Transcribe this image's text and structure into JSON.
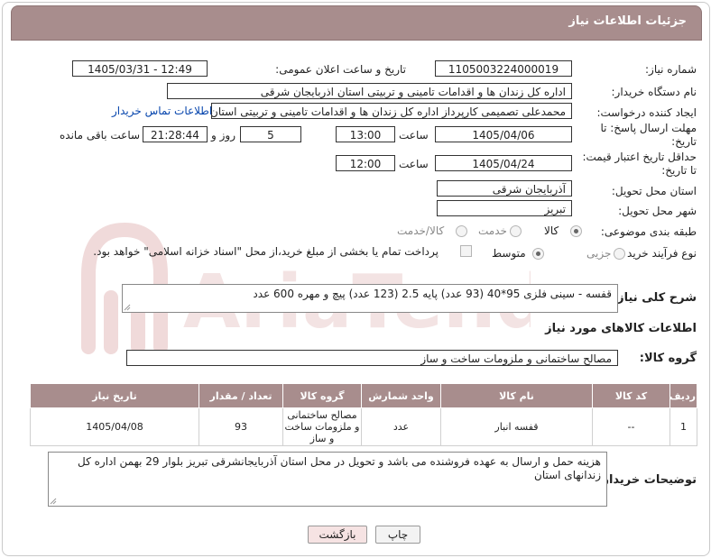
{
  "header": {
    "title": "جزئیات اطلاعات نیاز"
  },
  "fields": {
    "need_number": {
      "label": "شماره نیاز:",
      "value": "1105003224000019"
    },
    "announce": {
      "label": "تاریخ و ساعت اعلان عمومی:",
      "value": "1405/03/31 - 12:49"
    },
    "buyer_org": {
      "label": "نام دستگاه خریدار:",
      "value": "اداره کل زندان ها و اقدامات تامینی و تربیتی استان اذربایجان شرقی"
    },
    "requester": {
      "label": "ایجاد کننده درخواست:",
      "value": "محمدعلی تصمیمی کارپرداز اداره کل زندان ها و اقدامات تامینی و تربیتی استان",
      "contact_link": "اطلاعات تماس خریدار"
    },
    "reply_deadline": {
      "label_line1": "مهلت ارسال پاسخ: تا",
      "label_line2": "تاریخ:",
      "date": "1405/04/06",
      "time_label": "ساعت",
      "time": "13:00",
      "days": "5",
      "days_label": "روز و",
      "remaining": "21:28:44",
      "remaining_label": "ساعت باقی مانده"
    },
    "price_validity": {
      "label_line1": "حداقل تاریخ اعتبار قیمت:",
      "label_line2": "تا تاریخ:",
      "date": "1405/04/24",
      "time_label": "ساعت",
      "time": "12:00"
    },
    "delivery_province": {
      "label": "استان محل تحویل:",
      "value": "آذربایجان شرقی"
    },
    "delivery_city": {
      "label": "شهر محل تحویل:",
      "value": "تبریز"
    },
    "category": {
      "label": "طبقه بندی موضوعی:",
      "options": [
        "کالا",
        "خدمت",
        "کالا/خدمت"
      ],
      "selected": "کالا"
    },
    "process": {
      "label": "نوع فرآیند خرید :",
      "options": [
        "جزیی",
        "متوسط"
      ],
      "selected": "متوسط",
      "payment_note": "پرداخت تمام یا بخشی از مبلغ خرید،از محل \"اسناد خزانه اسلامی\" خواهد بود."
    }
  },
  "description": {
    "label": "شرح کلی نیاز:",
    "value": "قفسه - سینی فلزی 95*40 (93 عدد) پایه 2.5 (123 عدد) پیچ و مهره 600 عدد"
  },
  "goods": {
    "section_title": "اطلاعات کالاهای مورد نیاز",
    "group_label": "گروه کالا:",
    "group_value": "مصالح ساختمانی و ملزومات ساخت و ساز",
    "columns": [
      "ردیف",
      "کد کالا",
      "نام کالا",
      "واحد شمارش",
      "گروه کالا",
      "تعداد / مقدار",
      "تاریخ نیاز"
    ],
    "rows": [
      {
        "index": "1",
        "code": "--",
        "name": "قفسه انبار",
        "unit": "عدد",
        "group": "مصالح ساختمانی و ملزومات ساخت و ساز",
        "qty": "93",
        "date": "1405/04/08"
      }
    ]
  },
  "buyer_notes": {
    "label": "توضیحات خریدار:",
    "value": "هزینه حمل و ارسال به عهده فروشنده می باشد و تحویل در محل استان آذربایجانشرقی تبریز بلوار 29 بهمن اداره کل زندانهای استان"
  },
  "buttons": {
    "print": "چاپ",
    "back": "بازگشت"
  },
  "watermark": {
    "text": "AriaTender.net"
  },
  "colors": {
    "header": "#a88d8d",
    "back_button": "#f6e3e3",
    "link": "#0645ad"
  }
}
